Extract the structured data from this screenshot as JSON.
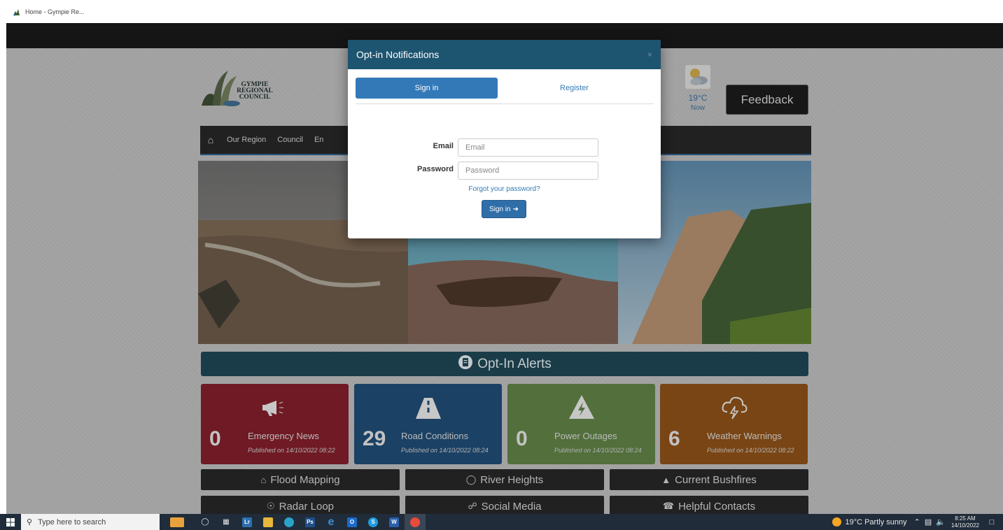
{
  "browser": {
    "tab_title": "Home - Gympie Re..."
  },
  "site": {
    "logo_text_line1": "GYMPIE",
    "logo_text_line2": "REGIONAL",
    "logo_text_line3": "COUNCIL",
    "weather": {
      "temp": "19°C",
      "label": "Now",
      "icon": "partly-sunny-icon"
    },
    "feedback_label": "Feedback",
    "nav": {
      "home_icon": "home-icon",
      "items": [
        "Our Region",
        "Council",
        "En"
      ]
    },
    "optin_bar_label": "Opt-In Alerts",
    "tiles": [
      {
        "count": "0",
        "title": "Emergency News",
        "date": "Published on 14/10/2022 08:22",
        "icon": "megaphone-icon",
        "color": "#7f1e2a"
      },
      {
        "count": "29",
        "title": "Road Conditions",
        "date": "Published on 14/10/2022 08:24",
        "icon": "road-icon",
        "color": "#1f4a72"
      },
      {
        "count": "0",
        "title": "Power Outages",
        "date": "Published on 14/10/2022 08:24",
        "icon": "lightning-icon",
        "color": "#5e7f45"
      },
      {
        "count": "6",
        "title": "Weather Warnings",
        "date": "Published on 14/10/2022 08:22",
        "icon": "storm-icon",
        "color": "#8a4f17"
      }
    ],
    "buttons": {
      "flood": "Flood Mapping",
      "river": "River Heights",
      "bushfires": "Current Bushfires",
      "radar": "Radar Loop",
      "social": "Social Media",
      "contacts": "Helpful Contacts"
    }
  },
  "modal": {
    "title": "Opt-in Notifications",
    "close": "×",
    "tab_signin": "Sign in",
    "tab_register": "Register",
    "email_label": "Email",
    "email_placeholder": "Email",
    "email_value": "",
    "password_label": "Password",
    "password_placeholder": "Password",
    "password_value": "",
    "forgot": "Forgot your password?",
    "submit": "Sign in"
  },
  "taskbar": {
    "search_placeholder": "Type here to search",
    "tray_weather": "19°C  Partly sunny",
    "time": "8:25 AM",
    "date": "14/10/2022"
  }
}
